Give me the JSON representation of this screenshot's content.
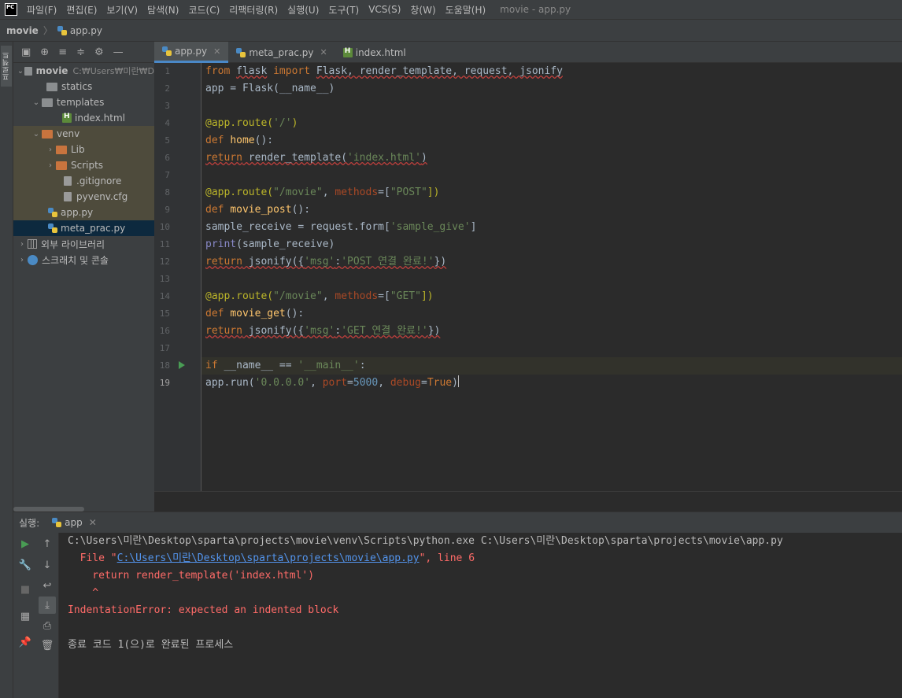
{
  "app": {
    "logo_text": "PC",
    "menu": [
      "파일(F)",
      "편집(E)",
      "보기(V)",
      "탐색(N)",
      "코드(C)",
      "리팩터링(R)",
      "실행(U)",
      "도구(T)",
      "VCS(S)",
      "창(W)",
      "도움말(H)"
    ],
    "window_title": "movie - app.py"
  },
  "navbar": {
    "project": "movie",
    "file": "app.py"
  },
  "left_stripe": {
    "tab_label": "프로젝트"
  },
  "project_tree": {
    "root_name": "movie",
    "root_path": "C:₩Users₩미란₩D",
    "statics": "statics",
    "templates": "templates",
    "index_html": "index.html",
    "venv": "venv",
    "lib": "Lib",
    "scripts": "Scripts",
    "gitignore": ".gitignore",
    "pyvenv": "pyvenv.cfg",
    "app_py": "app.py",
    "meta_prac": "meta_prac.py",
    "external_libs": "외부 라이브러리",
    "scratches": "스크래치 및 콘솔"
  },
  "editor_tabs": [
    {
      "label": "app.py",
      "close": "✕"
    },
    {
      "label": "meta_prac.py",
      "close": "✕"
    },
    {
      "label": "index.html"
    }
  ],
  "editor": {
    "line_numbers": [
      "1",
      "2",
      "3",
      "4",
      "5",
      "6",
      "7",
      "8",
      "9",
      "10",
      "11",
      "12",
      "13",
      "14",
      "15",
      "16",
      "17",
      "18",
      "19"
    ],
    "code": {
      "l1": {
        "from": "from",
        "flask": "flask",
        "import": "import",
        "names": "Flask, render_template, request, jsonify"
      },
      "l2": {
        "text": "app = Flask(__name__)"
      },
      "l4": {
        "dec": "@app.route(",
        "arg": "'/'",
        "close": ")"
      },
      "l5": {
        "def": "def ",
        "name": "home",
        "rest": "():"
      },
      "l6": {
        "ret": "return",
        "call": " render_template(",
        "arg": "'index.html'",
        "close": ")"
      },
      "l8": {
        "dec": "@app.route(",
        "arg": "\"/movie\"",
        "comma": ", ",
        "param": "methods",
        "eq": "=[",
        "val": "\"POST\"",
        "close": "])"
      },
      "l9": {
        "def": "def ",
        "name": "movie_post",
        "rest": "():"
      },
      "l10": {
        "lhs": "sample_receive = request.form[",
        "arg": "'sample_give'",
        "close": "]"
      },
      "l11": {
        "print": "print",
        "rest": "(sample_receive)"
      },
      "l12": {
        "ret": "return",
        "call": " jsonify({",
        "key": "'msg'",
        "colon": ":",
        "val": "'POST 연결 완료!'",
        "close": "})"
      },
      "l14": {
        "dec": "@app.route(",
        "arg": "\"/movie\"",
        "comma": ", ",
        "param": "methods",
        "eq": "=[",
        "val": "\"GET\"",
        "close": "])"
      },
      "l15": {
        "def": "def ",
        "name": "movie_get",
        "rest": "():"
      },
      "l16": {
        "ret": "return",
        "call": " jsonify({",
        "key": "'msg'",
        "colon": ":",
        "val": "'GET 연결 완료!'",
        "close": "})"
      },
      "l18": {
        "if": "if",
        "mid": " __name__ == ",
        "val": "'__main__'",
        "close": ":"
      },
      "l19": {
        "a": "app.run(",
        "arg1": "'0.0.0.0'",
        "c1": ", ",
        "p1": "port",
        "e1": "=",
        "v1": "5000",
        "c2": ", ",
        "p2": "debug",
        "e2": "=",
        "v2": "True",
        "close": ")"
      }
    }
  },
  "run_panel": {
    "label": "실행:",
    "tab": "app",
    "tab_close": "✕",
    "output": {
      "cmd": "C:\\Users\\미란\\Desktop\\sparta\\projects\\movie\\venv\\Scripts\\python.exe C:\\Users\\미란\\Desktop\\sparta\\projects\\movie\\app.py",
      "file_prefix": "  File \"",
      "file_link": "C:\\Users\\미란\\Desktop\\sparta\\projects\\movie\\app.py",
      "file_suffix": "\", line 6",
      "code_line": "    return render_template('index.html')",
      "caret_line": "    ^",
      "error": "IndentationError: expected an indented block",
      "exit": "종료 코드 1(으)로 완료된 프로세스"
    }
  },
  "colors": {
    "keyword": "#cc7832",
    "string": "#6a8759",
    "decorator": "#bbb529",
    "function": "#ffc66d",
    "error": "#ff6b68",
    "link": "#5394ec",
    "accent": "#4a88c7"
  }
}
